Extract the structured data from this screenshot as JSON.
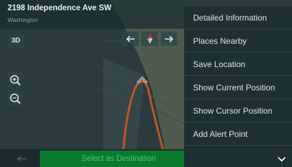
{
  "header": {
    "address": "2198 Independence Ave SW",
    "city": "Washington"
  },
  "map_controls": {
    "view_mode_label": "3D"
  },
  "bottom": {
    "select_label": "Select as Destination"
  },
  "menu": {
    "items": [
      {
        "label": "Detailed Information"
      },
      {
        "label": "Places Nearby"
      },
      {
        "label": "Save Location"
      },
      {
        "label": "Show Current Position"
      },
      {
        "label": "Show Cursor Position"
      },
      {
        "label": "Add Alert Point"
      }
    ]
  },
  "colors": {
    "route": "#c2581f",
    "select_button": "#0b7a2f",
    "menu_background": "#1f3033"
  },
  "icons": [
    "arrow-left-icon",
    "arrow-right-icon",
    "compass-icon",
    "zoom-in-icon",
    "zoom-out-icon",
    "cursor-icon",
    "back-arrow-icon",
    "chevron-down-icon"
  ]
}
